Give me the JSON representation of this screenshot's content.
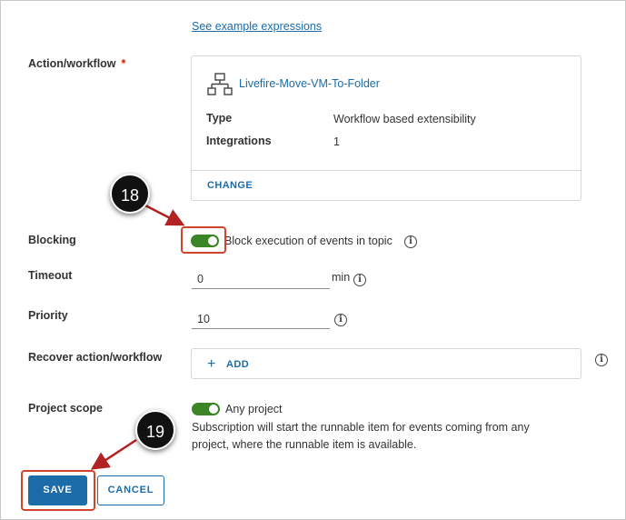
{
  "example_link": "See example expressions",
  "action_workflow": {
    "label": "Action/workflow",
    "required_marker": "*",
    "icon": "workflow-hierarchy-icon",
    "title": "Livefire-Move-VM-To-Folder",
    "type_key": "Type",
    "type_value": "Workflow based extensibility",
    "integrations_key": "Integrations",
    "integrations_value": "1",
    "change_label": "CHANGE"
  },
  "blocking": {
    "label": "Blocking",
    "enabled": true,
    "description": "Block execution of events in topic",
    "info_icon": "i"
  },
  "timeout": {
    "label": "Timeout",
    "value": "0",
    "unit": "min",
    "info_icon": "i"
  },
  "priority": {
    "label": "Priority",
    "value": "10",
    "info_icon": "i"
  },
  "recover": {
    "label": "Recover action/workflow",
    "add_symbol": "+",
    "add_label": "ADD",
    "info_icon": "i"
  },
  "project_scope": {
    "label": "Project scope",
    "enabled": true,
    "toggle_label": "Any project",
    "help_line1": "Subscription will start the runnable item for events coming from any",
    "help_line2": "project, where the runnable item is available."
  },
  "buttons": {
    "save": "SAVE",
    "cancel": "CANCEL"
  },
  "annotations": {
    "step_blocking": "18",
    "step_save": "19",
    "highlight_color": "#d0442c",
    "arrow_color": "#b22222"
  },
  "colors": {
    "accent": "#1b6ca8",
    "toggle_on": "#3c8524",
    "required": "#c92100"
  }
}
